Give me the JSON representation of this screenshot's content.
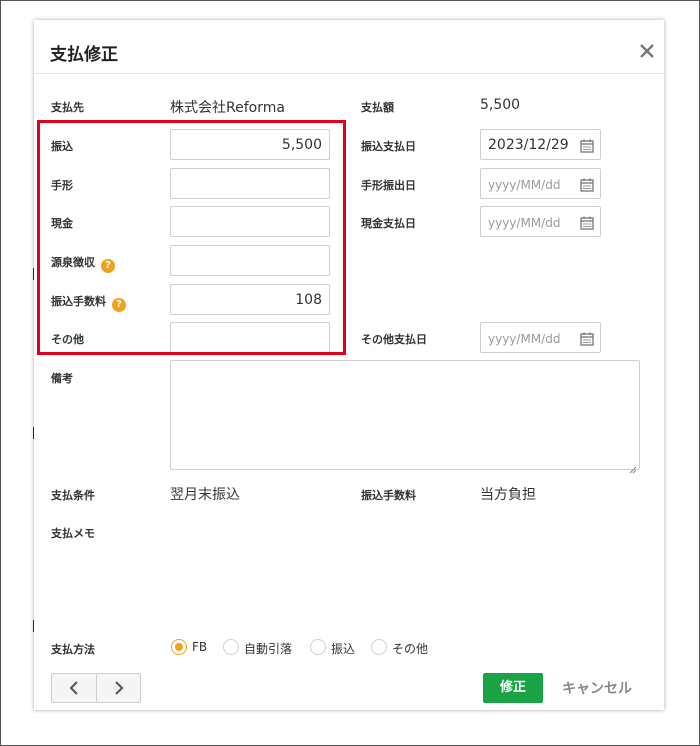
{
  "dialog": {
    "title": "支払修正"
  },
  "payee": {
    "label": "支払先",
    "value": "株式会社Reforma"
  },
  "amount": {
    "label": "支払額",
    "value": "5,500"
  },
  "transfer": {
    "label": "振込",
    "value": "5,500"
  },
  "transfer_date": {
    "label": "振込支払日",
    "value": "2023/12/29"
  },
  "bill": {
    "label": "手形",
    "value": ""
  },
  "bill_date": {
    "label": "手形振出日",
    "placeholder": "yyyy/MM/dd"
  },
  "cash": {
    "label": "現金",
    "value": ""
  },
  "cash_date": {
    "label": "現金支払日",
    "placeholder": "yyyy/MM/dd"
  },
  "withholding": {
    "label": "源泉徴収",
    "value": ""
  },
  "transfer_fee": {
    "label": "振込手数料",
    "value": "108"
  },
  "other": {
    "label": "その他",
    "value": ""
  },
  "other_date": {
    "label": "その他支払日",
    "placeholder": "yyyy/MM/dd"
  },
  "remarks": {
    "label": "備考",
    "value": ""
  },
  "terms": {
    "label": "支払条件",
    "value": "翌月末振込"
  },
  "fee_bearer": {
    "label": "振込手数料",
    "value": "当方負担"
  },
  "memo": {
    "label": "支払メモ"
  },
  "method": {
    "label": "支払方法",
    "options": [
      "FB",
      "自動引落",
      "振込",
      "その他"
    ],
    "selected": "FB"
  },
  "buttons": {
    "save": "修正",
    "cancel": "キャンセル"
  },
  "help_glyph": "?",
  "colors": {
    "accent": "#f0a11e",
    "save": "#1aa345",
    "highlight": "#e0001b"
  }
}
